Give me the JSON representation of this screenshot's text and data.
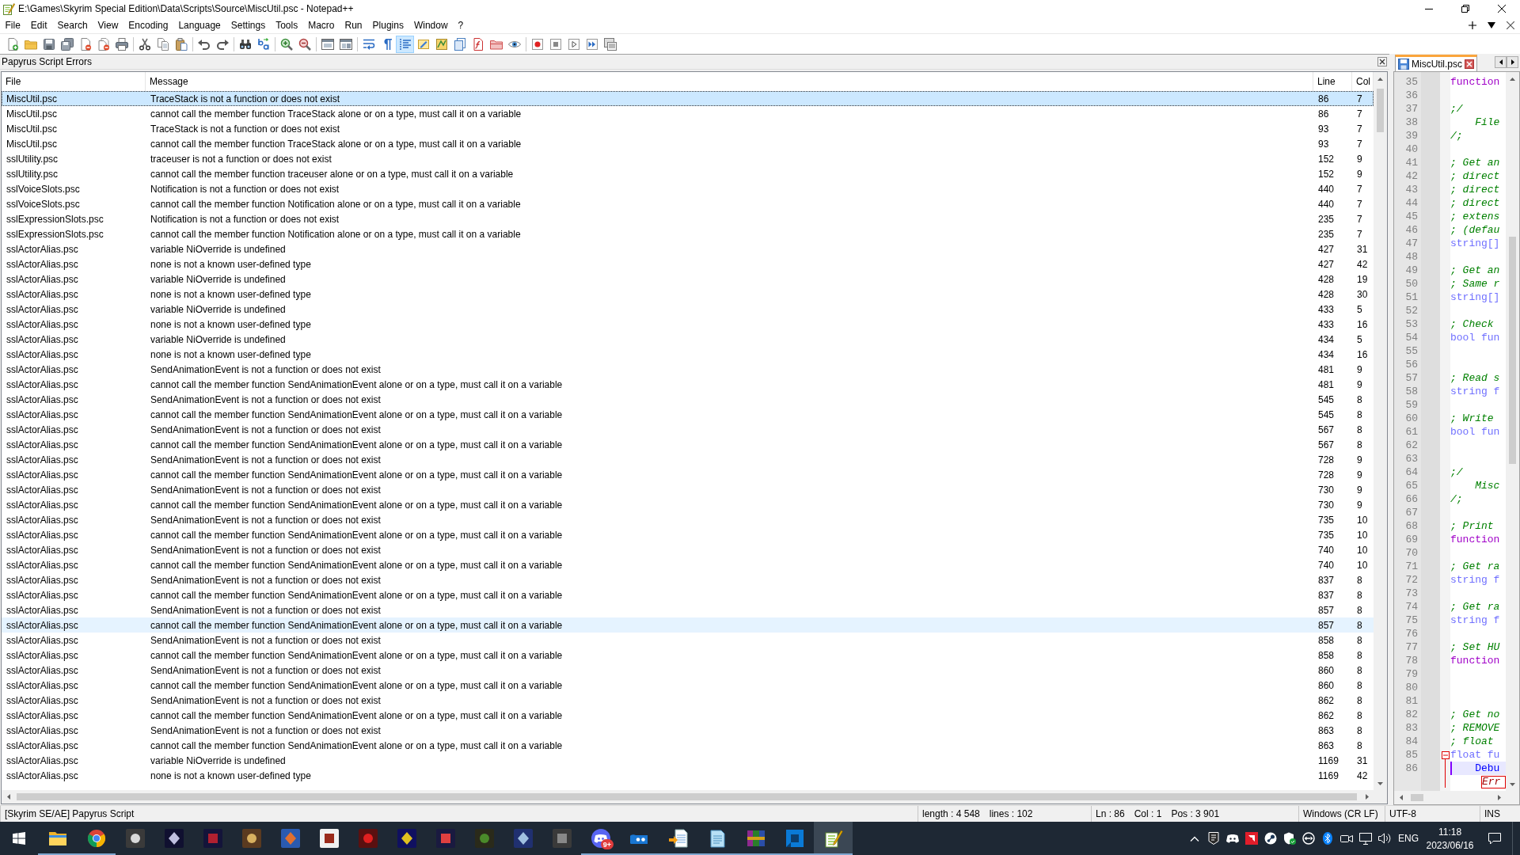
{
  "window": {
    "title": "E:\\Games\\Skyrim Special Edition\\Data\\Scripts\\Source\\MiscUtil.psc - Notepad++"
  },
  "menu": [
    "File",
    "Edit",
    "Search",
    "View",
    "Encoding",
    "Language",
    "Settings",
    "Tools",
    "Macro",
    "Run",
    "Plugins",
    "Window",
    "?"
  ],
  "toolbar": {
    "groups": [
      [
        {
          "on": false
        },
        {
          "on": false
        },
        {
          "on": false
        },
        {
          "on": false
        },
        {
          "on": false
        },
        {
          "on": false
        },
        {
          "on": false
        }
      ],
      [
        {
          "on": false
        },
        {
          "on": false
        },
        {
          "on": false
        }
      ],
      [
        {
          "on": false
        },
        {
          "on": false
        }
      ],
      [
        {
          "on": false
        },
        {
          "on": false
        }
      ],
      [
        {
          "on": false
        },
        {
          "on": false
        }
      ],
      [
        {
          "on": false
        },
        {
          "on": false
        }
      ],
      [
        {
          "on": false
        },
        {
          "on": false
        },
        {
          "on": true
        },
        {
          "on": false
        },
        {
          "on": false
        },
        {
          "on": false
        },
        {
          "on": false
        },
        {
          "on": false
        },
        {
          "on": false
        }
      ],
      [
        {
          "on": false
        },
        {
          "on": false
        },
        {
          "on": false
        },
        {
          "on": false
        },
        {
          "on": false
        }
      ]
    ]
  },
  "error_panel": {
    "title": "Papyrus Script Errors",
    "columns": [
      "File",
      "Message",
      "Line",
      "Col"
    ],
    "rows": [
      {
        "file": "MiscUtil.psc",
        "message": "TraceStack is not a function or does not exist",
        "line": "86",
        "col": "7",
        "selected": true,
        "hovered": false
      },
      {
        "file": "MiscUtil.psc",
        "message": "cannot call the member function TraceStack alone or on a type, must call it on a variable",
        "line": "86",
        "col": "7",
        "selected": false,
        "hovered": false
      },
      {
        "file": "MiscUtil.psc",
        "message": "TraceStack is not a function or does not exist",
        "line": "93",
        "col": "7",
        "selected": false,
        "hovered": false
      },
      {
        "file": "MiscUtil.psc",
        "message": "cannot call the member function TraceStack alone or on a type, must call it on a variable",
        "line": "93",
        "col": "7",
        "selected": false,
        "hovered": false
      },
      {
        "file": "sslUtility.psc",
        "message": "traceuser is not a function or does not exist",
        "line": "152",
        "col": "9",
        "selected": false,
        "hovered": false
      },
      {
        "file": "sslUtility.psc",
        "message": "cannot call the member function traceuser alone or on a type, must call it on a variable",
        "line": "152",
        "col": "9",
        "selected": false,
        "hovered": false
      },
      {
        "file": "sslVoiceSlots.psc",
        "message": "Notification is not a function or does not exist",
        "line": "440",
        "col": "7",
        "selected": false,
        "hovered": false
      },
      {
        "file": "sslVoiceSlots.psc",
        "message": "cannot call the member function Notification alone or on a type, must call it on a variable",
        "line": "440",
        "col": "7",
        "selected": false,
        "hovered": false
      },
      {
        "file": "sslExpressionSlots.psc",
        "message": "Notification is not a function or does not exist",
        "line": "235",
        "col": "7",
        "selected": false,
        "hovered": false
      },
      {
        "file": "sslExpressionSlots.psc",
        "message": "cannot call the member function Notification alone or on a type, must call it on a variable",
        "line": "235",
        "col": "7",
        "selected": false,
        "hovered": false
      },
      {
        "file": "sslActorAlias.psc",
        "message": "variable NiOverride is undefined",
        "line": "427",
        "col": "31",
        "selected": false,
        "hovered": false
      },
      {
        "file": "sslActorAlias.psc",
        "message": "none is not a known user-defined type",
        "line": "427",
        "col": "42",
        "selected": false,
        "hovered": false
      },
      {
        "file": "sslActorAlias.psc",
        "message": "variable NiOverride is undefined",
        "line": "428",
        "col": "19",
        "selected": false,
        "hovered": false
      },
      {
        "file": "sslActorAlias.psc",
        "message": "none is not a known user-defined type",
        "line": "428",
        "col": "30",
        "selected": false,
        "hovered": false
      },
      {
        "file": "sslActorAlias.psc",
        "message": "variable NiOverride is undefined",
        "line": "433",
        "col": "5",
        "selected": false,
        "hovered": false
      },
      {
        "file": "sslActorAlias.psc",
        "message": "none is not a known user-defined type",
        "line": "433",
        "col": "16",
        "selected": false,
        "hovered": false
      },
      {
        "file": "sslActorAlias.psc",
        "message": "variable NiOverride is undefined",
        "line": "434",
        "col": "5",
        "selected": false,
        "hovered": false
      },
      {
        "file": "sslActorAlias.psc",
        "message": "none is not a known user-defined type",
        "line": "434",
        "col": "16",
        "selected": false,
        "hovered": false
      },
      {
        "file": "sslActorAlias.psc",
        "message": "SendAnimationEvent is not a function or does not exist",
        "line": "481",
        "col": "9",
        "selected": false,
        "hovered": false
      },
      {
        "file": "sslActorAlias.psc",
        "message": "cannot call the member function SendAnimationEvent alone or on a type, must call it on a variable",
        "line": "481",
        "col": "9",
        "selected": false,
        "hovered": false
      },
      {
        "file": "sslActorAlias.psc",
        "message": "SendAnimationEvent is not a function or does not exist",
        "line": "545",
        "col": "8",
        "selected": false,
        "hovered": false
      },
      {
        "file": "sslActorAlias.psc",
        "message": "cannot call the member function SendAnimationEvent alone or on a type, must call it on a variable",
        "line": "545",
        "col": "8",
        "selected": false,
        "hovered": false
      },
      {
        "file": "sslActorAlias.psc",
        "message": "SendAnimationEvent is not a function or does not exist",
        "line": "567",
        "col": "8",
        "selected": false,
        "hovered": false
      },
      {
        "file": "sslActorAlias.psc",
        "message": "cannot call the member function SendAnimationEvent alone or on a type, must call it on a variable",
        "line": "567",
        "col": "8",
        "selected": false,
        "hovered": false
      },
      {
        "file": "sslActorAlias.psc",
        "message": "SendAnimationEvent is not a function or does not exist",
        "line": "728",
        "col": "9",
        "selected": false,
        "hovered": false
      },
      {
        "file": "sslActorAlias.psc",
        "message": "cannot call the member function SendAnimationEvent alone or on a type, must call it on a variable",
        "line": "728",
        "col": "9",
        "selected": false,
        "hovered": false
      },
      {
        "file": "sslActorAlias.psc",
        "message": "SendAnimationEvent is not a function or does not exist",
        "line": "730",
        "col": "9",
        "selected": false,
        "hovered": false
      },
      {
        "file": "sslActorAlias.psc",
        "message": "cannot call the member function SendAnimationEvent alone or on a type, must call it on a variable",
        "line": "730",
        "col": "9",
        "selected": false,
        "hovered": false
      },
      {
        "file": "sslActorAlias.psc",
        "message": "SendAnimationEvent is not a function or does not exist",
        "line": "735",
        "col": "10",
        "selected": false,
        "hovered": false
      },
      {
        "file": "sslActorAlias.psc",
        "message": "cannot call the member function SendAnimationEvent alone or on a type, must call it on a variable",
        "line": "735",
        "col": "10",
        "selected": false,
        "hovered": false
      },
      {
        "file": "sslActorAlias.psc",
        "message": "SendAnimationEvent is not a function or does not exist",
        "line": "740",
        "col": "10",
        "selected": false,
        "hovered": false
      },
      {
        "file": "sslActorAlias.psc",
        "message": "cannot call the member function SendAnimationEvent alone or on a type, must call it on a variable",
        "line": "740",
        "col": "10",
        "selected": false,
        "hovered": false
      },
      {
        "file": "sslActorAlias.psc",
        "message": "SendAnimationEvent is not a function or does not exist",
        "line": "837",
        "col": "8",
        "selected": false,
        "hovered": false
      },
      {
        "file": "sslActorAlias.psc",
        "message": "cannot call the member function SendAnimationEvent alone or on a type, must call it on a variable",
        "line": "837",
        "col": "8",
        "selected": false,
        "hovered": false
      },
      {
        "file": "sslActorAlias.psc",
        "message": "SendAnimationEvent is not a function or does not exist",
        "line": "857",
        "col": "8",
        "selected": false,
        "hovered": false
      },
      {
        "file": "sslActorAlias.psc",
        "message": "cannot call the member function SendAnimationEvent alone or on a type, must call it on a variable",
        "line": "857",
        "col": "8",
        "selected": false,
        "hovered": true
      },
      {
        "file": "sslActorAlias.psc",
        "message": "SendAnimationEvent is not a function or does not exist",
        "line": "858",
        "col": "8",
        "selected": false,
        "hovered": false
      },
      {
        "file": "sslActorAlias.psc",
        "message": "cannot call the member function SendAnimationEvent alone or on a type, must call it on a variable",
        "line": "858",
        "col": "8",
        "selected": false,
        "hovered": false
      },
      {
        "file": "sslActorAlias.psc",
        "message": "SendAnimationEvent is not a function or does not exist",
        "line": "860",
        "col": "8",
        "selected": false,
        "hovered": false
      },
      {
        "file": "sslActorAlias.psc",
        "message": "cannot call the member function SendAnimationEvent alone or on a type, must call it on a variable",
        "line": "860",
        "col": "8",
        "selected": false,
        "hovered": false
      },
      {
        "file": "sslActorAlias.psc",
        "message": "SendAnimationEvent is not a function or does not exist",
        "line": "862",
        "col": "8",
        "selected": false,
        "hovered": false
      },
      {
        "file": "sslActorAlias.psc",
        "message": "cannot call the member function SendAnimationEvent alone or on a type, must call it on a variable",
        "line": "862",
        "col": "8",
        "selected": false,
        "hovered": false
      },
      {
        "file": "sslActorAlias.psc",
        "message": "SendAnimationEvent is not a function or does not exist",
        "line": "863",
        "col": "8",
        "selected": false,
        "hovered": false
      },
      {
        "file": "sslActorAlias.psc",
        "message": "cannot call the member function SendAnimationEvent alone or on a type, must call it on a variable",
        "line": "863",
        "col": "8",
        "selected": false,
        "hovered": false
      },
      {
        "file": "sslActorAlias.psc",
        "message": "variable NiOverride is undefined",
        "line": "1169",
        "col": "31",
        "selected": false,
        "hovered": false
      },
      {
        "file": "sslActorAlias.psc",
        "message": "none is not a known user-defined type",
        "line": "1169",
        "col": "42",
        "selected": false,
        "hovered": false
      }
    ]
  },
  "editor": {
    "tabs": [
      {
        "label": "MiscUtil.psc",
        "selected": true
      }
    ],
    "lines": [
      {
        "number": "35",
        "text": "function",
        "kind": "keyword",
        "current": false
      },
      {
        "number": "36",
        "current": false
      },
      {
        "number": "37",
        "text": ";/",
        "kind": "comment",
        "current": false
      },
      {
        "number": "38",
        "text": "    File",
        "kind": "comment",
        "current": false
      },
      {
        "number": "39",
        "text": "/;",
        "kind": "comment",
        "current": false
      },
      {
        "number": "40",
        "current": false
      },
      {
        "number": "41",
        "text": "; Get an",
        "kind": "comment",
        "current": false
      },
      {
        "number": "42",
        "text": "; direct",
        "kind": "comment",
        "current": false
      },
      {
        "number": "43",
        "text": "; direct",
        "kind": "comment",
        "current": false
      },
      {
        "number": "44",
        "text": "; direct",
        "kind": "comment",
        "current": false
      },
      {
        "number": "45",
        "text": "; extens",
        "kind": "comment",
        "current": false
      },
      {
        "number": "46",
        "text": "; (defau",
        "kind": "comment",
        "current": false
      },
      {
        "number": "47",
        "text": "string[]",
        "kind": "type",
        "current": false
      },
      {
        "number": "48",
        "current": false
      },
      {
        "number": "49",
        "text": "; Get an",
        "kind": "comment",
        "current": false
      },
      {
        "number": "50",
        "text": "; Same r",
        "kind": "comment",
        "current": false
      },
      {
        "number": "51",
        "text": "string[]",
        "kind": "type",
        "current": false
      },
      {
        "number": "52",
        "current": false
      },
      {
        "number": "53",
        "text": "; Check",
        "kind": "comment",
        "current": false
      },
      {
        "number": "54",
        "text": "bool fun",
        "kind": "type",
        "current": false
      },
      {
        "number": "55",
        "current": false
      },
      {
        "number": "56",
        "current": false
      },
      {
        "number": "57",
        "text": "; Read s",
        "kind": "comment",
        "current": false
      },
      {
        "number": "58",
        "text": "string f",
        "kind": "type",
        "current": false
      },
      {
        "number": "59",
        "current": false
      },
      {
        "number": "60",
        "text": "; Write",
        "kind": "comment",
        "current": false
      },
      {
        "number": "61",
        "text": "bool fun",
        "kind": "type",
        "current": false
      },
      {
        "number": "62",
        "current": false
      },
      {
        "number": "63",
        "current": false
      },
      {
        "number": "64",
        "text": ";/",
        "kind": "comment",
        "current": false
      },
      {
        "number": "65",
        "text": "    Misc",
        "kind": "comment",
        "current": false
      },
      {
        "number": "66",
        "text": "/;",
        "kind": "comment",
        "current": false
      },
      {
        "number": "67",
        "current": false
      },
      {
        "number": "68",
        "text": "; Print",
        "kind": "comment",
        "current": false
      },
      {
        "number": "69",
        "text": "function",
        "kind": "keyword",
        "current": false
      },
      {
        "number": "70",
        "current": false
      },
      {
        "number": "71",
        "text": "; Get ra",
        "kind": "comment",
        "current": false
      },
      {
        "number": "72",
        "text": "string f",
        "kind": "type",
        "current": false
      },
      {
        "number": "73",
        "current": false
      },
      {
        "number": "74",
        "text": "; Get ra",
        "kind": "comment",
        "current": false
      },
      {
        "number": "75",
        "text": "string f",
        "kind": "type",
        "current": false
      },
      {
        "number": "76",
        "current": false
      },
      {
        "number": "77",
        "text": "; Set HU",
        "kind": "comment",
        "current": false
      },
      {
        "number": "78",
        "text": "function",
        "kind": "keyword",
        "current": false
      },
      {
        "number": "79",
        "current": false
      },
      {
        "number": "80",
        "current": false
      },
      {
        "number": "81",
        "current": false
      },
      {
        "number": "82",
        "text": "; Get no",
        "kind": "comment",
        "current": false
      },
      {
        "number": "83",
        "text": "; REMOVE",
        "kind": "comment",
        "current": false
      },
      {
        "number": "84",
        "text": "; float",
        "kind": "comment",
        "current": false
      },
      {
        "number": "85",
        "text": "float fu",
        "kind": "type",
        "current": false,
        "expanded": true,
        "children": [
          {
            "number": "86",
            "text": "    Debu",
            "kind": "call",
            "current": true
          },
          {
            "text": "     Err",
            "kind": "error",
            "current": false
          }
        ]
      }
    ]
  },
  "status_bar": {
    "language": "[Skyrim SE/AE] Papyrus Script",
    "length": "length : 4 548",
    "lines": "lines : 102",
    "ln": "Ln : 86",
    "col": "Col : 1",
    "pos": "Pos : 3 901",
    "eol": "Windows (CR LF)",
    "encoding": "UTF-8",
    "mode": "INS"
  },
  "taskbar": {
    "apps": [
      {
        "running": true,
        "active": false
      },
      {
        "running": true,
        "active": false
      },
      {
        "running": false,
        "active": false
      },
      {
        "running": false,
        "active": false
      },
      {
        "running": false,
        "active": false
      },
      {
        "running": false,
        "active": false
      },
      {
        "running": false,
        "active": false
      },
      {
        "running": false,
        "active": false
      },
      {
        "running": false,
        "active": false
      },
      {
        "running": false,
        "active": false
      },
      {
        "running": false,
        "active": false
      },
      {
        "running": false,
        "active": false
      },
      {
        "running": false,
        "active": false
      },
      {
        "running": false,
        "active": false
      },
      {
        "running": true,
        "active": false,
        "badge": "9+"
      },
      {
        "running": true,
        "active": false
      },
      {
        "running": true,
        "active": false
      },
      {
        "running": true,
        "active": false
      },
      {
        "running": true,
        "active": false
      },
      {
        "running": true,
        "active": false
      },
      {
        "running": true,
        "active": true
      }
    ],
    "tray": {
      "language": "ENG",
      "time": "11:18",
      "date": "2023/06/16"
    }
  }
}
